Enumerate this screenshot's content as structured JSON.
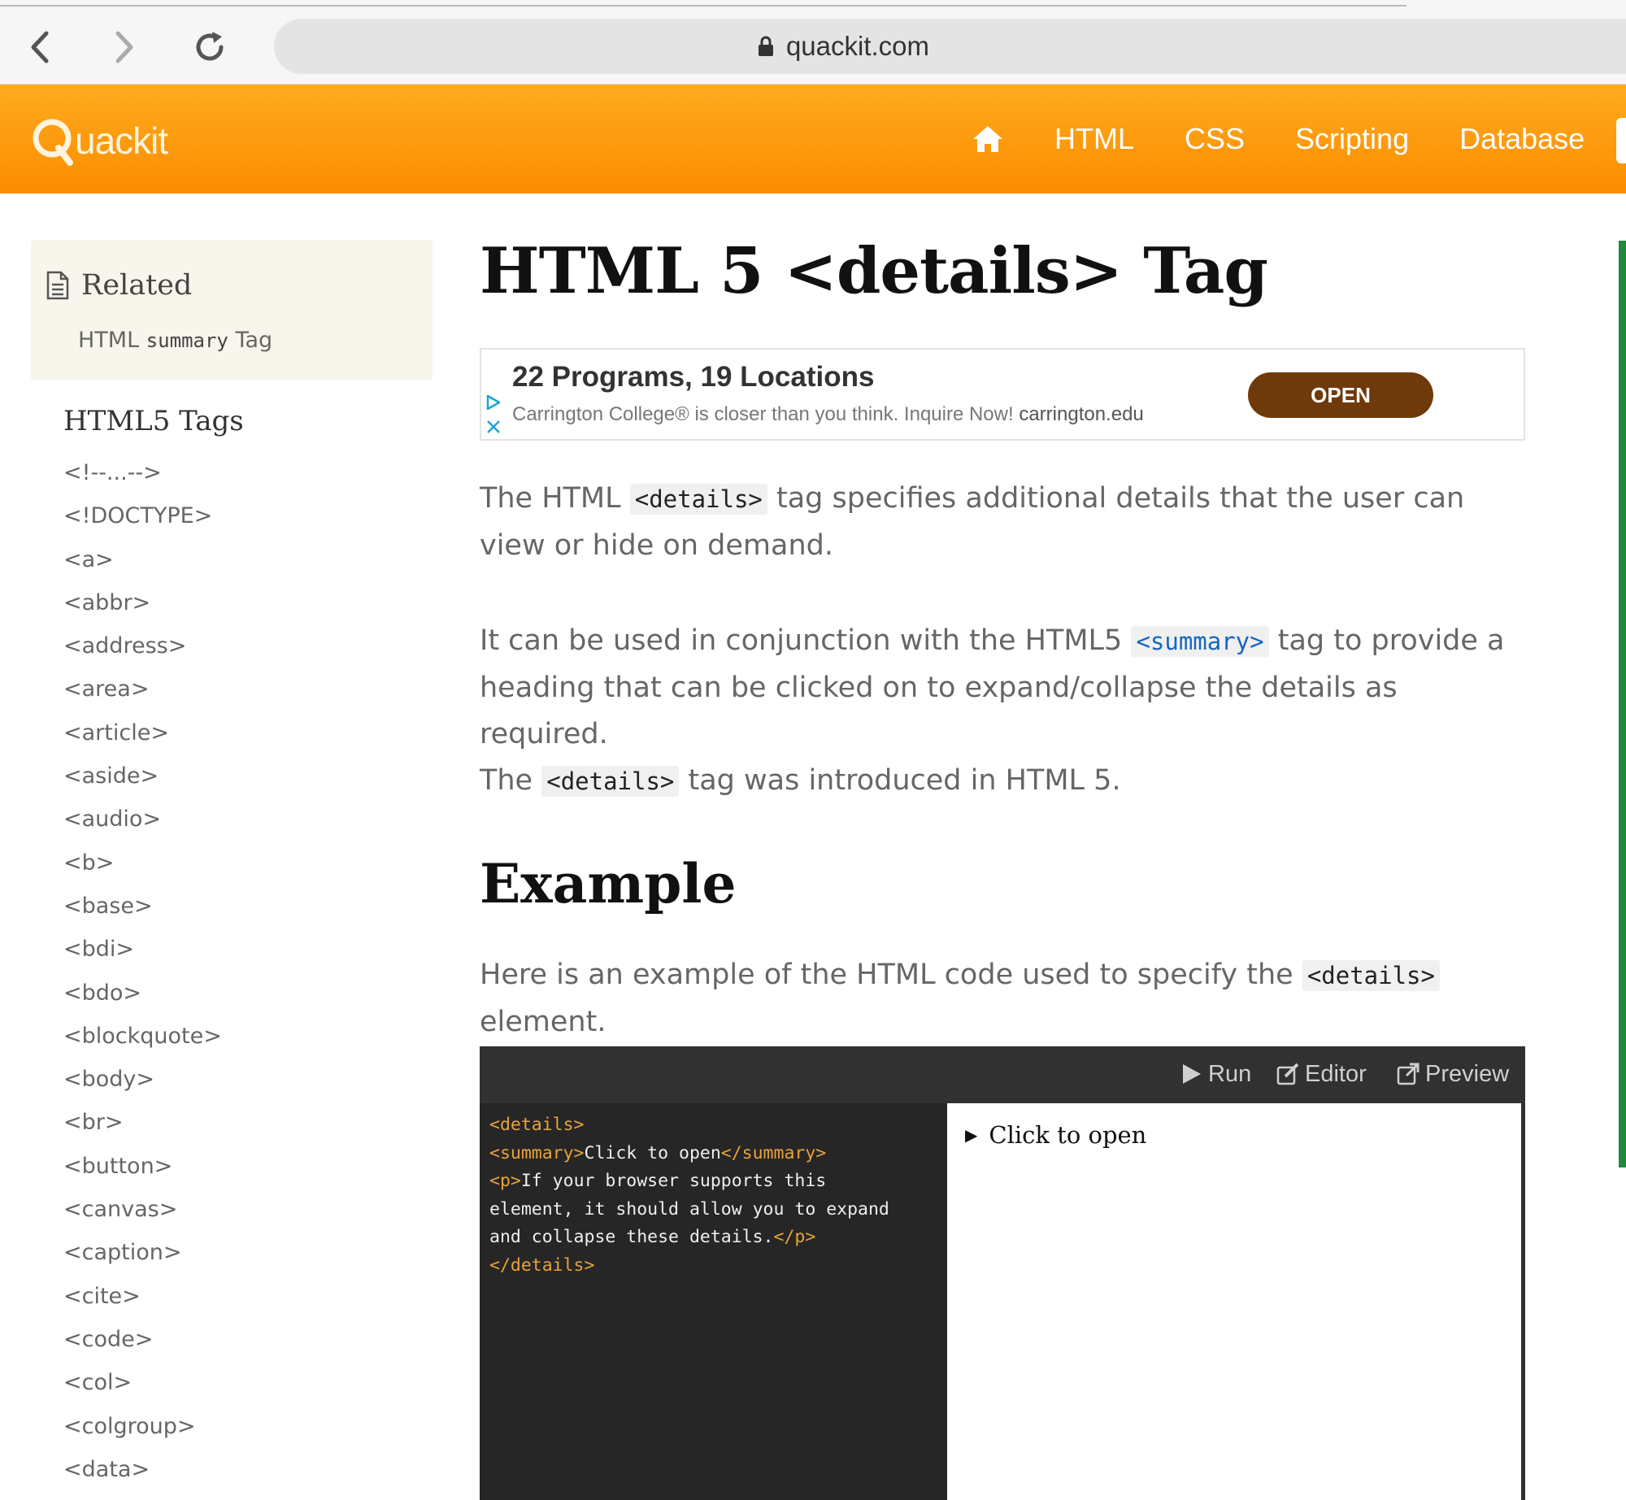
{
  "browser": {
    "url": "quackit.com"
  },
  "site": {
    "logo_text": "uackit",
    "nav": [
      "HTML",
      "CSS",
      "Scripting",
      "Database"
    ]
  },
  "sidebar": {
    "related_title": "Related",
    "related_link_pre": "HTML ",
    "related_link_code": "summary",
    "related_link_post": " Tag",
    "tags_title": "HTML5 Tags",
    "tags": [
      "<!--...-->",
      "<!DOCTYPE>",
      "<a>",
      "<abbr>",
      "<address>",
      "<area>",
      "<article>",
      "<aside>",
      "<audio>",
      "<b>",
      "<base>",
      "<bdi>",
      "<bdo>",
      "<blockquote>",
      "<body>",
      "<br>",
      "<button>",
      "<canvas>",
      "<caption>",
      "<cite>",
      "<code>",
      "<col>",
      "<colgroup>",
      "<data>"
    ]
  },
  "main": {
    "title": "HTML 5 <details> Tag",
    "ad": {
      "title": "22 Programs, 19 Locations",
      "text": "Carrington College® is closer than you think. Inquire Now! ",
      "domain": "carrington.edu",
      "button": "OPEN"
    },
    "p1_a": "The HTML ",
    "p1_code": "<details>",
    "p1_b": " tag specifies additional details that the user can view or hide on demand.",
    "p2_a": "It can be used in conjunction with the HTML5 ",
    "p2_code": "<summary>",
    "p2_b": " tag to provide a heading that can be clicked on to expand/collapse the details as required.",
    "p3_a": "The ",
    "p3_code": "<details>",
    "p3_b": " tag was introduced in HTML 5.",
    "example_title": "Example",
    "p4_a": "Here is an example of the HTML code used to specify the ",
    "p4_code": "<details>",
    "p4_b": " element.",
    "editor": {
      "run": "Run",
      "editor": "Editor",
      "preview": "Preview",
      "code": {
        "l1_tag": "<details>",
        "l2_open": "<summary>",
        "l2_text": "Click to open",
        "l2_close": "</summary>",
        "l3_open": "<p>",
        "l3_text": "If your browser supports this",
        "l4_text": "element, it should allow you to expand",
        "l5_text": "and collapse these details.",
        "l5_close": "</p>",
        "l6_tag": "</details>"
      },
      "preview_summary": "Click to open",
      "preview_marker": "▶"
    }
  }
}
